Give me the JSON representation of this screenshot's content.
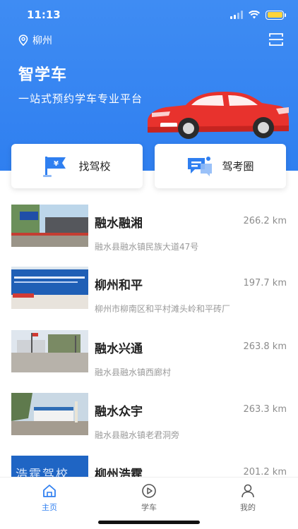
{
  "status_bar": {
    "time": "11:13"
  },
  "header": {
    "location": "柳州",
    "title": "智学车",
    "subtitle": "一站式预约学车专业平台"
  },
  "actions": [
    {
      "label": "找驾校",
      "icon": "flag-yuan-icon"
    },
    {
      "label": "驾考圈",
      "icon": "chat-bubble-icon"
    }
  ],
  "schools": [
    {
      "name": "融水融湘",
      "distance": "266.2 km",
      "address": "融水县融水镇民族大道47号"
    },
    {
      "name": "柳州和平",
      "distance": "197.7 km",
      "address": "柳州市柳南区和平村滩头岭和平砖厂"
    },
    {
      "name": "融水兴通",
      "distance": "263.8 km",
      "address": "融水县融水镇西廊村"
    },
    {
      "name": "融水众宇",
      "distance": "263.3 km",
      "address": "融水县融水镇老君洞旁"
    },
    {
      "name": "柳州浩霆",
      "distance": "201.2 km",
      "address": ""
    }
  ],
  "thumb_text": {
    "school5_sign": "浩霆驾校"
  },
  "tabs": [
    {
      "label": "主页",
      "icon": "home-icon",
      "active": true
    },
    {
      "label": "学车",
      "icon": "play-circle-icon",
      "active": false
    },
    {
      "label": "我的",
      "icon": "user-icon",
      "active": false
    }
  ],
  "colors": {
    "accent": "#2f7ff0",
    "car_body": "#e8322d"
  }
}
